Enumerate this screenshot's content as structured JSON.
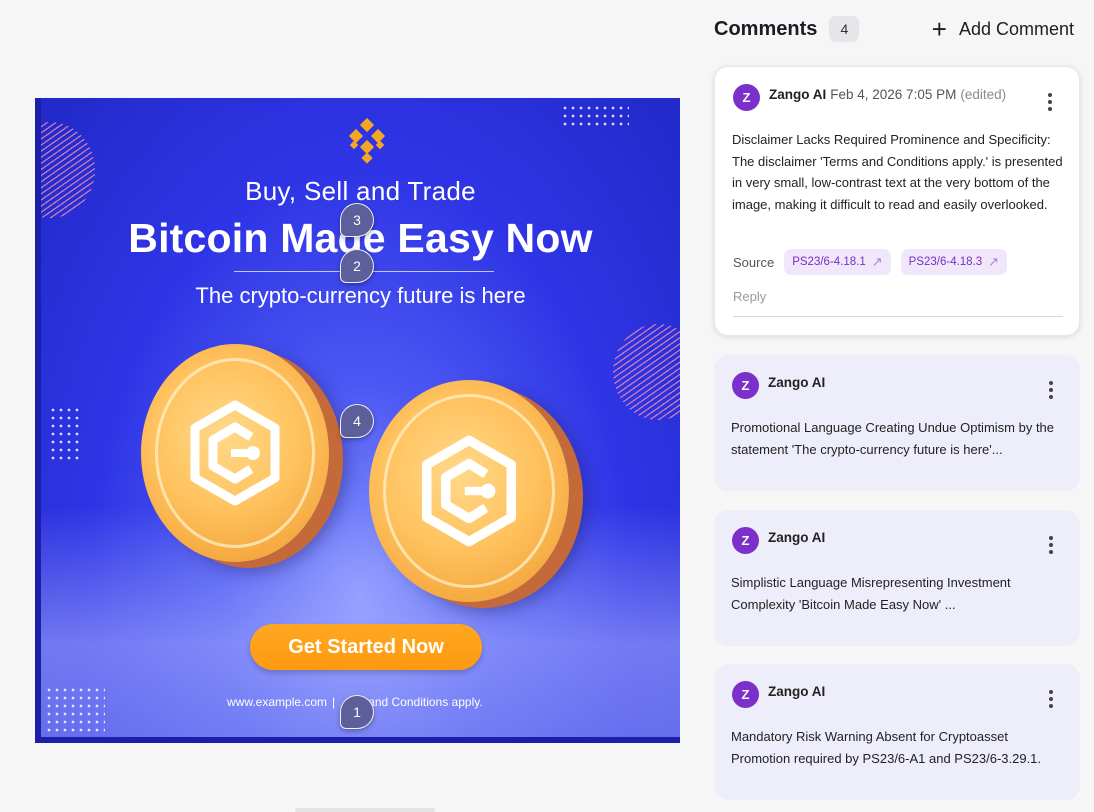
{
  "ad": {
    "tagline": "Buy, Sell and Trade",
    "headline": "Bitcoin Made Easy Now",
    "subheadline": "The crypto-currency future is here",
    "cta_label": "Get Started Now",
    "footer_url": "www.example.com",
    "footer_sep": "|",
    "footer_terms": "and Conditions apply.",
    "coin_icon": "coin-c-logo-icon",
    "brand_icon": "diamond-logo-icon",
    "colors": {
      "background": "#2f35e6",
      "cta": "#ff9a10",
      "coin": "#ffc25e",
      "pin": "#5c5f9a"
    }
  },
  "pins": [
    {
      "label": "3"
    },
    {
      "label": "2"
    },
    {
      "label": "4"
    },
    {
      "label": "1"
    }
  ],
  "comments_panel": {
    "title": "Comments",
    "count": "4",
    "add_label": "Add Comment",
    "add_icon": "plus-icon",
    "comments": [
      {
        "avatar": "Z",
        "author": "Zango AI",
        "date": "Feb 4, 2026 7:05 PM",
        "edited": "(edited)",
        "text": "Disclaimer Lacks Required Prominence and Specificity: The disclaimer 'Terms and Conditions apply.' is presented in very small, low-contrast text at the very bottom of the image, making it difficult to read and easily overlooked.",
        "source_label": "Source",
        "sources": [
          "PS23/6-4.18.1",
          "PS23/6-4.18.3"
        ],
        "reply_placeholder": "Reply"
      },
      {
        "avatar": "Z",
        "author": "Zango AI",
        "text": "Promotional Language Creating Undue Optimism by the statement 'The crypto-currency future is here'..."
      },
      {
        "avatar": "Z",
        "author": "Zango AI",
        "text": "Simplistic Language Misrepresenting Investment Complexity 'Bitcoin Made Easy Now' ..."
      },
      {
        "avatar": "Z",
        "author": "Zango AI",
        "text": "Mandatory Risk Warning Absent for Cryptoasset Promotion required by PS23/6-A1 and PS23/6-3.29.1."
      }
    ]
  }
}
